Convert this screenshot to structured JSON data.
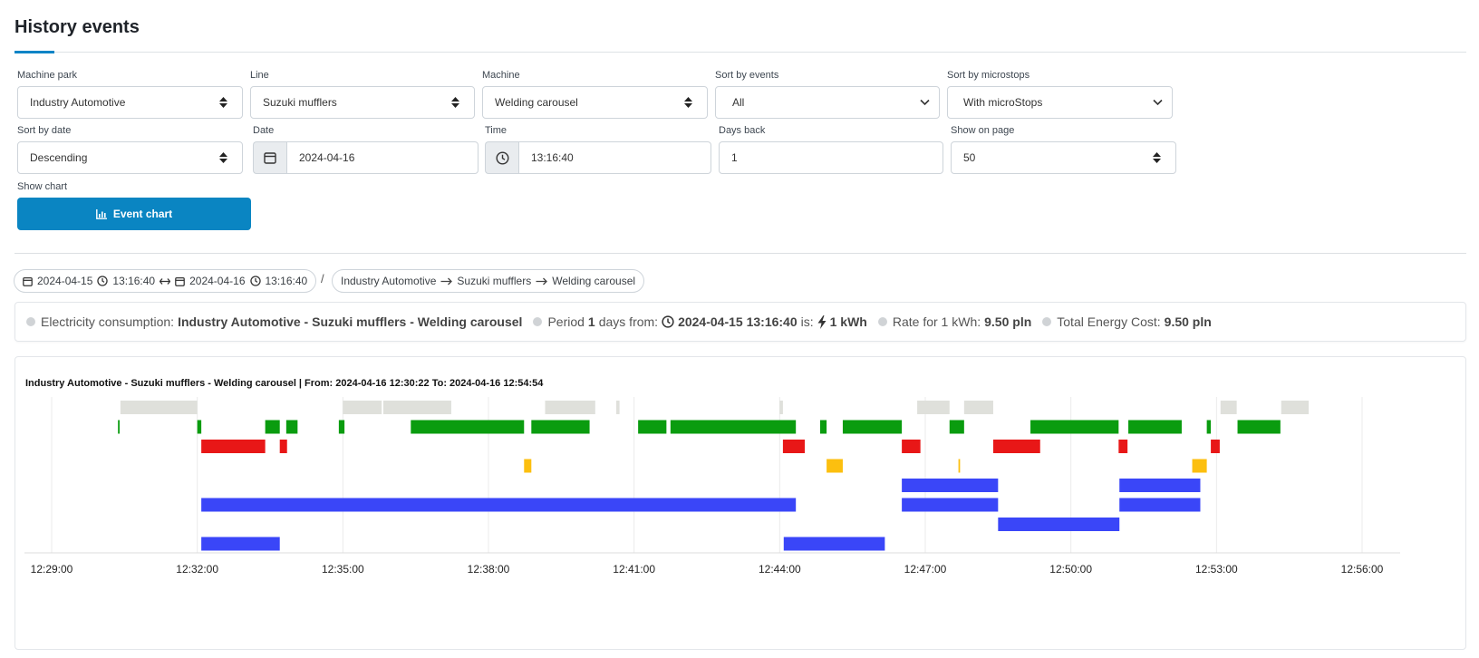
{
  "page": {
    "title": "History events"
  },
  "filters": {
    "machine_park": {
      "label": "Machine park",
      "value": "Industry Automotive"
    },
    "line": {
      "label": "Line",
      "value": "Suzuki mufflers"
    },
    "machine": {
      "label": "Machine",
      "value": "Welding carousel"
    },
    "sort_events": {
      "label": "Sort by events",
      "value": "All"
    },
    "sort_microstops": {
      "label": "Sort by microstops",
      "value": "With microStops"
    },
    "sort_date": {
      "label": "Sort by date",
      "value": "Descending"
    },
    "date": {
      "label": "Date",
      "value": "2024-04-16"
    },
    "time": {
      "label": "Time",
      "value": "13:16:40"
    },
    "days_back": {
      "label": "Days back",
      "value": "1"
    },
    "show_on_page": {
      "label": "Show on page",
      "value": "50"
    },
    "show_chart": {
      "label": "Show chart",
      "button": "Event chart"
    }
  },
  "range": {
    "from_date": "2024-04-15",
    "from_time": "13:16:40",
    "to_date": "2024-04-16",
    "to_time": "13:16:40",
    "separator": "/",
    "path": [
      "Industry Automotive",
      "Suzuki mufflers",
      "Welding carousel"
    ]
  },
  "energy": {
    "consumption_label": "Electricity consumption:",
    "consumption_value": "Industry Automotive - Suzuki mufflers - Welding carousel",
    "period_prefix": "Period",
    "period_days": "1",
    "period_mid": "days from:",
    "period_from": "2024-04-15 13:16:40",
    "period_is": "is:",
    "kwh": "1 kWh",
    "rate_label": "Rate for 1 kWh:",
    "rate_value": "9.50 pln",
    "total_label": "Total Energy Cost:",
    "total_value": "9.50 pln"
  },
  "colors": {
    "accent": "#0a84c6",
    "button": "#0a85c2",
    "gray": "#dfe0db",
    "green": "#0a9c0f",
    "red": "#e81717",
    "yellow": "#fcbf0f",
    "blue": "#3a46f8"
  },
  "chart_data": {
    "type": "timeline",
    "title": "Industry Automotive - Suzuki mufflers - Welding carousel | From: 2024-04-16 12:30:22 To: 2024-04-16 12:54:54",
    "x_range": [
      "12:29:00",
      "12:56:00"
    ],
    "x_ticks": [
      "12:29:00",
      "12:32:00",
      "12:35:00",
      "12:38:00",
      "12:41:00",
      "12:44:00",
      "12:47:00",
      "12:50:00",
      "12:53:00",
      "12:56:00"
    ],
    "grid": true,
    "rows": [
      {
        "color": "gray",
        "segments": [
          [
            "12:30:25",
            "12:32:00"
          ],
          [
            "12:35:00",
            "12:35:48"
          ],
          [
            "12:35:50",
            "12:37:14"
          ],
          [
            "12:39:10",
            "12:40:12"
          ],
          [
            "12:40:38",
            "12:40:42"
          ],
          [
            "12:44:00",
            "12:44:04"
          ],
          [
            "12:46:50",
            "12:47:30"
          ],
          [
            "12:47:48",
            "12:48:24"
          ],
          [
            "12:53:05",
            "12:53:25"
          ],
          [
            "12:54:20",
            "12:54:54"
          ]
        ]
      },
      {
        "color": "green",
        "segments": [
          [
            "12:30:22",
            "12:30:24"
          ],
          [
            "12:32:00",
            "12:32:05"
          ],
          [
            "12:33:24",
            "12:33:42"
          ],
          [
            "12:33:50",
            "12:34:04"
          ],
          [
            "12:34:55",
            "12:35:02"
          ],
          [
            "12:36:24",
            "12:38:44"
          ],
          [
            "12:38:53",
            "12:40:05"
          ],
          [
            "12:41:05",
            "12:41:40"
          ],
          [
            "12:41:45",
            "12:44:20"
          ],
          [
            "12:44:50",
            "12:44:58"
          ],
          [
            "12:45:18",
            "12:46:31"
          ],
          [
            "12:47:30",
            "12:47:48"
          ],
          [
            "12:49:10",
            "12:50:59"
          ],
          [
            "12:51:11",
            "12:52:17"
          ],
          [
            "12:52:48",
            "12:52:53"
          ],
          [
            "12:53:26",
            "12:54:19"
          ]
        ]
      },
      {
        "color": "red",
        "segments": [
          [
            "12:32:05",
            "12:33:24"
          ],
          [
            "12:33:42",
            "12:33:51"
          ],
          [
            "12:44:04",
            "12:44:31"
          ],
          [
            "12:46:31",
            "12:46:54"
          ],
          [
            "12:48:24",
            "12:49:22"
          ],
          [
            "12:50:59",
            "12:51:10"
          ],
          [
            "12:52:53",
            "12:53:04"
          ]
        ]
      },
      {
        "color": "yellow",
        "segments": [
          [
            "12:38:44",
            "12:38:53"
          ],
          [
            "12:44:58",
            "12:45:18"
          ],
          [
            "12:47:41",
            "12:47:43"
          ],
          [
            "12:52:30",
            "12:52:48"
          ]
        ]
      },
      {
        "color": "blue",
        "segments": [
          [
            "12:46:31",
            "12:48:30"
          ],
          [
            "12:51:00",
            "12:52:40"
          ]
        ]
      },
      {
        "color": "blue",
        "segments": [
          [
            "12:32:05",
            "12:44:20"
          ],
          [
            "12:46:31",
            "12:48:30"
          ],
          [
            "12:51:00",
            "12:52:40"
          ]
        ]
      },
      {
        "color": "blue",
        "segments": [
          [
            "12:48:30",
            "12:51:00"
          ]
        ]
      },
      {
        "color": "blue",
        "segments": [
          [
            "12:32:05",
            "12:33:42"
          ],
          [
            "12:44:05",
            "12:46:10"
          ]
        ]
      }
    ]
  }
}
